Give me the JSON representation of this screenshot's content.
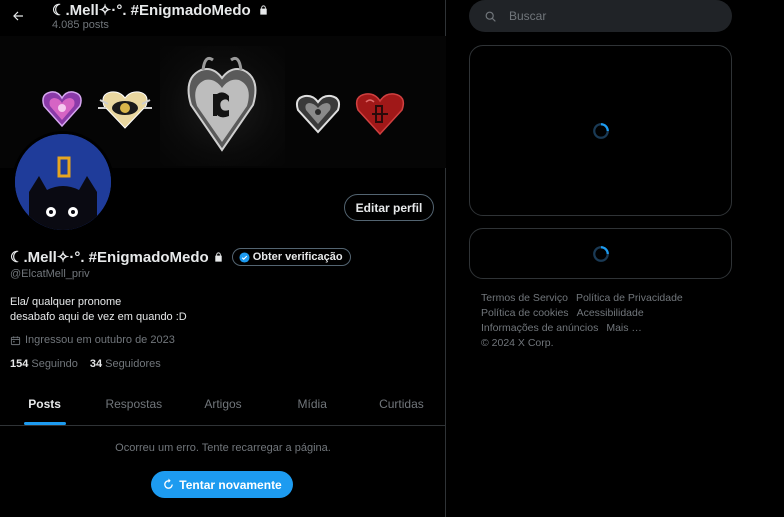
{
  "header": {
    "title": "☾.Mell✧·°. #EnigmadoMedo",
    "posts_count": "4.085 posts"
  },
  "profile": {
    "display_name": "☾.Mell✧·°. #EnigmadoMedo",
    "handle": "@ElcatMell_priv",
    "bio_line1": "Ela/ qualquer pronome",
    "bio_line2": "desabafo aqui de vez em quando :D",
    "joined": "Ingressou em outubro de 2023",
    "following_count": "154",
    "following_label": "Seguindo",
    "followers_count": "34",
    "followers_label": "Seguidores",
    "edit_label": "Editar perfil",
    "verify_label": "Obter verificação"
  },
  "tabs": [
    {
      "label": "Posts",
      "active": true
    },
    {
      "label": "Respostas",
      "active": false
    },
    {
      "label": "Artigos",
      "active": false
    },
    {
      "label": "Mídia",
      "active": false
    },
    {
      "label": "Curtidas",
      "active": false
    }
  ],
  "feed": {
    "error_text": "Ocorreu um erro. Tente recarregar a página.",
    "retry_label": "Tentar novamente"
  },
  "search": {
    "placeholder": "Buscar"
  },
  "footer": {
    "links": [
      "Termos de Serviço",
      "Política de Privacidade",
      "Política de cookies",
      "Acessibilidade",
      "Informações de anúncios",
      "Mais …"
    ],
    "copyright": "© 2024 X Corp."
  },
  "colors": {
    "accent": "#1d9bf0",
    "background": "#000000",
    "muted_text": "#71767b",
    "border": "#2f3336"
  },
  "icons": {
    "back": "arrow-left-icon",
    "lock": "lock-icon",
    "verified": "verified-badge-icon",
    "calendar": "calendar-icon",
    "search": "search-icon",
    "refresh": "refresh-icon",
    "spinner": "loading-spinner-icon"
  }
}
